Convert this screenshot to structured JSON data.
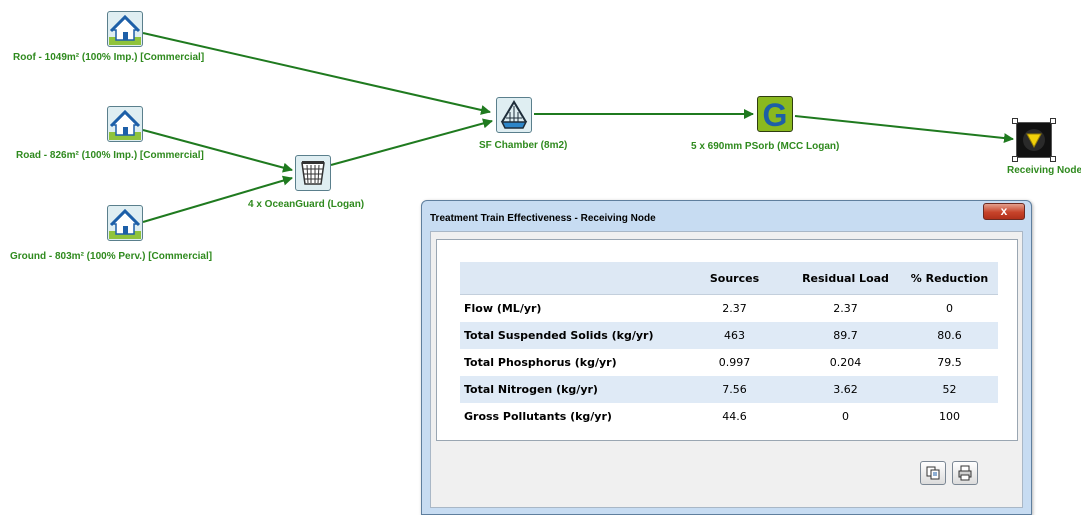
{
  "diagram": {
    "nodes": {
      "roof": {
        "label": "Roof - 1049m² (100% Imp.) [Commercial]",
        "icon": "house-icon"
      },
      "road": {
        "label": "Road - 826m² (100% Imp.) [Commercial]",
        "icon": "house-icon"
      },
      "ground": {
        "label": "Ground - 803m² (100% Perv.) [Commercial]",
        "icon": "house-icon"
      },
      "oceanguard": {
        "label": "4 x OceanGuard (Logan)",
        "icon": "gpt-basket-icon"
      },
      "sf_chamber": {
        "label": "SF Chamber (8m2)",
        "icon": "filter-chamber-icon"
      },
      "psorb": {
        "label": "5 x 690mm PSorb (MCC Logan)",
        "icon": "generic-treatment-g-icon"
      },
      "receiving": {
        "label": "Receiving Node",
        "icon": "receiving-node-icon"
      }
    },
    "link_color": "#1f7a1f"
  },
  "dialog": {
    "title": "Treatment Train Effectiveness - Receiving Node",
    "close_label": "x",
    "columns": [
      "",
      "Sources",
      "Residual Load",
      "% Reduction"
    ],
    "rows": [
      {
        "name": "Flow (ML/yr)",
        "sources": "2.37",
        "residual": "2.37",
        "reduction": "0"
      },
      {
        "name": "Total Suspended Solids (kg/yr)",
        "sources": "463",
        "residual": "89.7",
        "reduction": "80.6"
      },
      {
        "name": "Total Phosphorus (kg/yr)",
        "sources": "0.997",
        "residual": "0.204",
        "reduction": "79.5"
      },
      {
        "name": "Total Nitrogen (kg/yr)",
        "sources": "7.56",
        "residual": "3.62",
        "reduction": "52"
      },
      {
        "name": "Gross Pollutants (kg/yr)",
        "sources": "44.6",
        "residual": "0",
        "reduction": "100"
      }
    ],
    "buttons": {
      "copy": "copy-icon",
      "print": "print-icon"
    }
  }
}
